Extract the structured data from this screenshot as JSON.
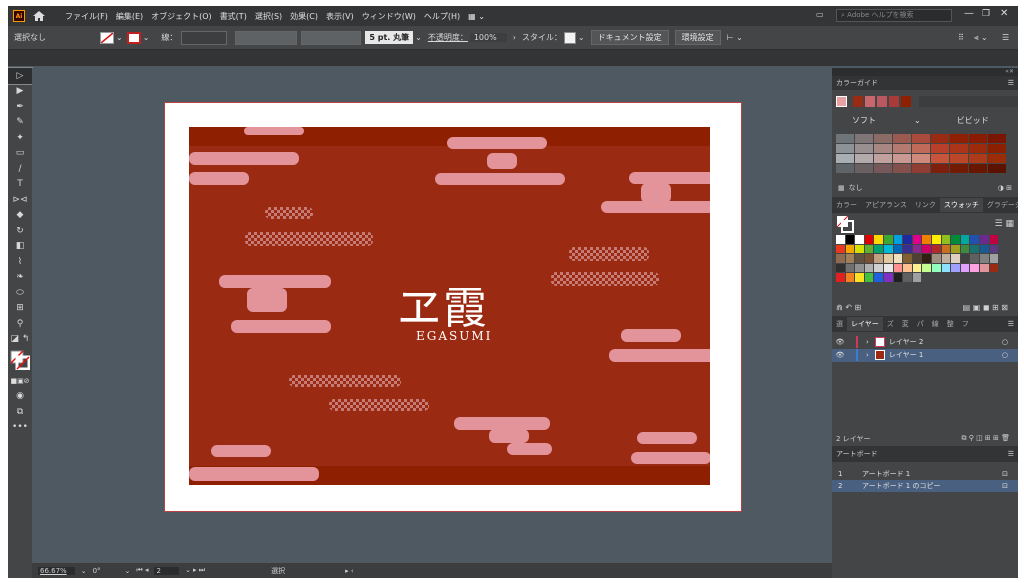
{
  "menubar": {
    "items": [
      "ファイル(F)",
      "編集(E)",
      "オブジェクト(O)",
      "書式(T)",
      "選択(S)",
      "効果(C)",
      "表示(V)",
      "ウィンドウ(W)",
      "ヘルプ(H)"
    ],
    "search_placeholder": "Adobe ヘルプを検索",
    "app_logo": "Ai"
  },
  "control": {
    "selection": "選択なし",
    "stroke_label": "線：",
    "stroke_brush": "5 pt. 丸筆",
    "opacity_label": "不透明度：",
    "opacity": "100%",
    "style_label": "スタイル：",
    "doc_settings": "ドキュメント設定",
    "prefs": "環境設定"
  },
  "artwork": {
    "kanji": "ヱ霞",
    "roman": "EGASUMI",
    "colors": {
      "bg": "#9b2a12",
      "band": "#8e1f00",
      "cloud": "#e3939a"
    }
  },
  "status": {
    "zoom": "66.67%",
    "rotate": "0°",
    "page": "2",
    "tool": "選択"
  },
  "color_guide": {
    "title": "カラーガイド",
    "soft": "ソフト",
    "vivid": "ビビッド",
    "none_label": "なし"
  },
  "swatch_tabs": [
    "カラー",
    "アピアランス",
    "リンク",
    "スウォッチ",
    "グラデーション"
  ],
  "layers_tabs": [
    "選",
    "レイヤー",
    "ズ",
    "変",
    "パ",
    "線",
    "整",
    "フ"
  ],
  "layers": [
    {
      "name": "レイヤー 2",
      "color": "#ce3b58"
    },
    {
      "name": "レイヤー 1",
      "color": "#3a7bd5"
    }
  ],
  "layers_count": "2 レイヤー",
  "artboards_title": "アートボード",
  "artboards": [
    {
      "num": "1",
      "name": "アートボード 1"
    },
    {
      "num": "2",
      "name": "アートボード 1 のコピー"
    }
  ]
}
